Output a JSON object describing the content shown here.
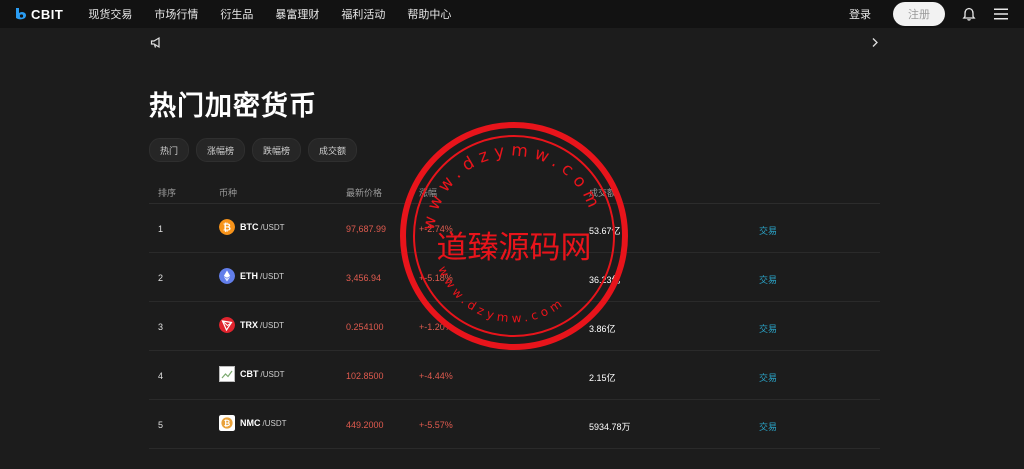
{
  "header": {
    "logo_text": "CBIT",
    "nav": [
      "现货交易",
      "市场行情",
      "衍生品",
      "暴富理财",
      "福利活动",
      "帮助中心"
    ],
    "login": "登录",
    "register": "注册"
  },
  "page": {
    "title": "热门加密货币",
    "tabs": [
      "热门",
      "涨幅榜",
      "跌幅榜",
      "成交额"
    ]
  },
  "table": {
    "headers": {
      "rank": "排序",
      "coin": "币种",
      "price": "最新价格",
      "change": "涨幅",
      "volume": "成交额"
    },
    "rows": [
      {
        "rank": "1",
        "symbol": "BTC",
        "quote": "/USDT",
        "price": "97,687.99",
        "change": "+-2.74%",
        "volume": "53.67亿",
        "action": "交易",
        "icon_color": "#f7931a",
        "icon": "bitcoin-icon"
      },
      {
        "rank": "2",
        "symbol": "ETH",
        "quote": "/USDT",
        "price": "3,456.94",
        "change": "+-5.18%",
        "volume": "36.23亿",
        "action": "交易",
        "icon_color": "#627eea",
        "icon": "ethereum-icon"
      },
      {
        "rank": "3",
        "symbol": "TRX",
        "quote": "/USDT",
        "price": "0.254100",
        "change": "+-1.20%",
        "volume": "3.86亿",
        "action": "交易",
        "icon_color": "#e0242e",
        "icon": "tron-icon"
      },
      {
        "rank": "4",
        "symbol": "CBT",
        "quote": "/USDT",
        "price": "102.8500",
        "change": "+-4.44%",
        "volume": "2.15亿",
        "action": "交易",
        "icon_color": "#ffffff",
        "icon": "broken-image-icon"
      },
      {
        "rank": "5",
        "symbol": "NMC",
        "quote": "/USDT",
        "price": "449.2000",
        "change": "+-5.57%",
        "volume": "5934.78万",
        "action": "交易",
        "icon_color": "#ffffff",
        "icon": "namecoin-icon"
      }
    ]
  },
  "watermark": {
    "text": "道臻源码网",
    "ring_text": "www.dzymw.com",
    "color": "#e8141b"
  }
}
